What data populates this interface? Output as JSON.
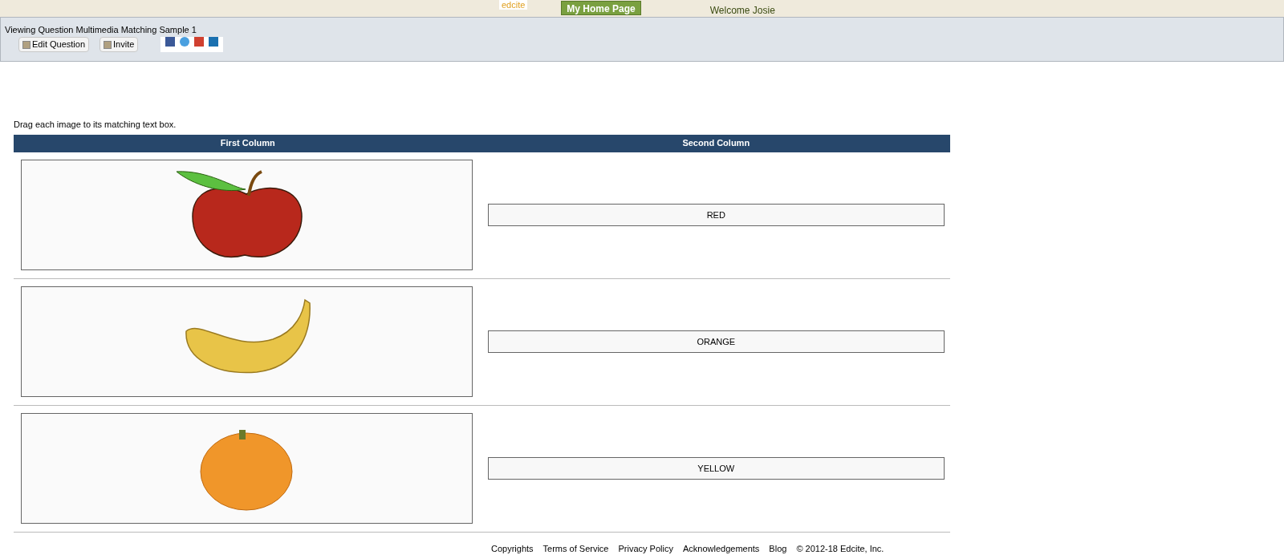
{
  "top_bar": {
    "logo": "edcite",
    "home_button": "My Home Page",
    "welcome": "Welcome Josie"
  },
  "header": {
    "title": "Viewing Question Multimedia Matching Sample 1",
    "buttons": [
      "Edit Question",
      "Invite"
    ]
  },
  "question": {
    "instruction": "Drag each image to its matching text box.",
    "columns": [
      "First Column",
      "Second Column"
    ],
    "rows": [
      {
        "kind": "apple",
        "answer": "RED"
      },
      {
        "kind": "banana",
        "answer": "ORANGE"
      },
      {
        "kind": "citrus",
        "answer": "YELLOW"
      }
    ]
  },
  "footer": {
    "links": [
      "Copyrights",
      "Terms of Service",
      "Privacy Policy",
      "Acknowledgements",
      "Blog"
    ],
    "copyright": "© 2012-18 Edcite, Inc."
  }
}
